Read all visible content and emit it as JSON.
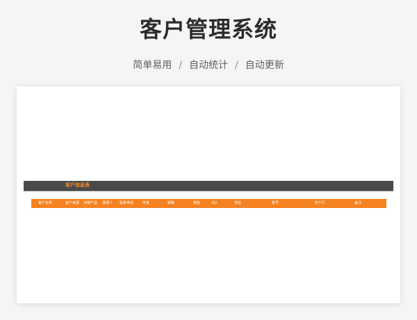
{
  "header": {
    "title": "客户管理系统",
    "subtitle_items": [
      "简单易用",
      "自动统计",
      "自动更新"
    ],
    "separator": "/"
  },
  "sheet": {
    "title": "客户信息表",
    "columns": [
      "客户名称",
      "客户来源",
      "对接产品",
      "联系人",
      "联系电话",
      "传真",
      "邮箱",
      "微信",
      "QQ",
      "地址",
      "账号",
      "开户行",
      "备注"
    ]
  },
  "colors": {
    "accent": "#f58220",
    "header_bar": "#4a4a4a",
    "title_text": "#2b2b2b",
    "background": "#f4f5f7"
  }
}
